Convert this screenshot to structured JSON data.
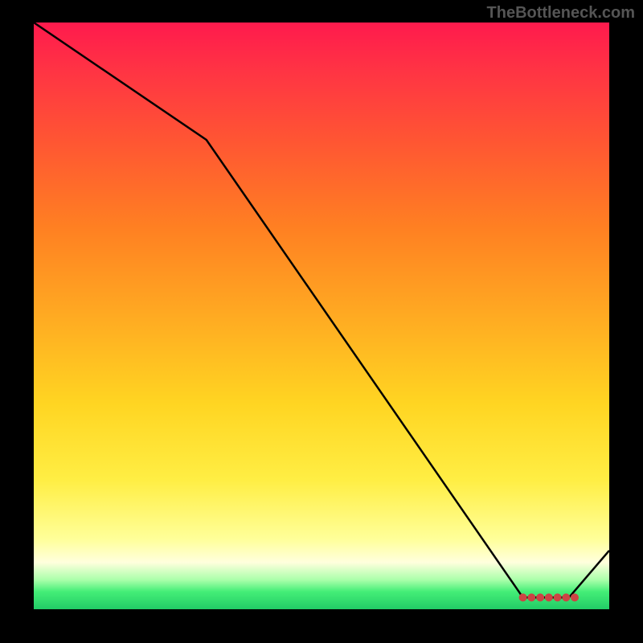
{
  "watermark": "TheBottleneck.com",
  "chart_data": {
    "type": "line",
    "title": "",
    "xlabel": "",
    "ylabel": "",
    "xlim": [
      0,
      100
    ],
    "ylim": [
      0,
      100
    ],
    "x": [
      0,
      30,
      85,
      93,
      100
    ],
    "values": [
      100,
      80,
      2,
      2,
      10
    ],
    "markers_x": [
      85,
      86.5,
      88,
      89.5,
      91,
      92.5,
      94
    ],
    "markers_y": [
      2,
      2,
      2,
      2,
      2,
      2,
      2
    ],
    "background": "rainbow-gradient",
    "grid": false,
    "series_color": "#000000",
    "marker_color": "#cc4444"
  }
}
